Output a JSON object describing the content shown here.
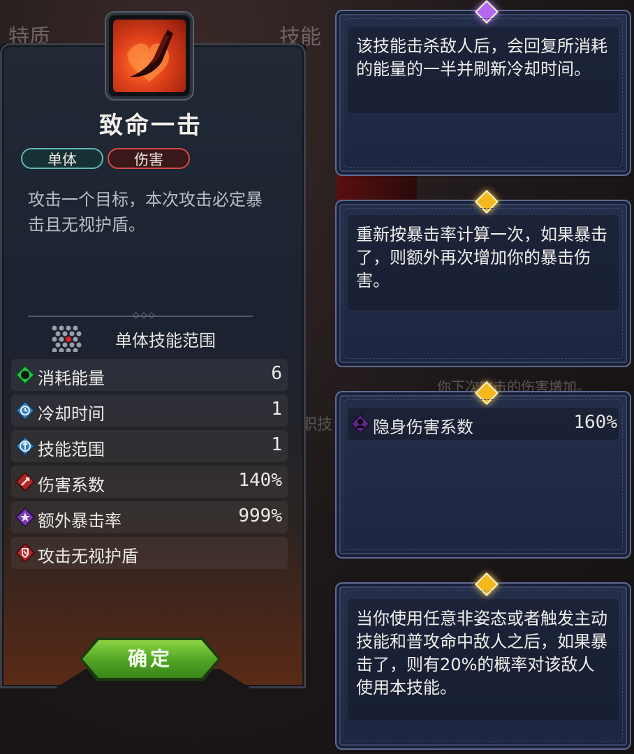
{
  "background": {
    "tab_traits": "特质",
    "tab_skills": "技能",
    "faded_text_1": "你下次攻击的伤害增加。",
    "faded_text_2": "职技"
  },
  "skill": {
    "name": "致命一击",
    "icon": "slash-attack-icon",
    "tags": [
      "单体",
      "伤害"
    ],
    "description": "攻击一个目标，本次攻击必定暴击且无视护盾。",
    "range_label": "单体技能范围",
    "stats": [
      {
        "icon": "energy-icon",
        "label": "消耗能量",
        "value": "6",
        "color": "#22c24a"
      },
      {
        "icon": "cooldown-icon",
        "label": "冷却时间",
        "value": "1",
        "color": "#3a7fb8"
      },
      {
        "icon": "range-icon",
        "label": "技能范围",
        "value": "1",
        "color": "#3a7fb8"
      },
      {
        "icon": "damage-icon",
        "label": "伤害系数",
        "value": "140%",
        "color": "#b0282a"
      },
      {
        "icon": "crit-icon",
        "label": "额外暴击率",
        "value": "999%",
        "color": "#7a3ab0"
      },
      {
        "icon": "shield-break-icon",
        "label": "攻击无视护盾",
        "value": "",
        "color": "#b0282a"
      }
    ],
    "confirm_label": "确定"
  },
  "cards": [
    {
      "gem": "purple",
      "text": "该技能击杀敌人后，会回复所消耗的能量的一半并刷新冷却时间。"
    },
    {
      "gem": "gold",
      "text": "重新按暴击率计算一次，如果暴击了，则额外再次增加你的暴击伤害。"
    },
    {
      "gem": "gold",
      "stat": {
        "icon": "stealth-icon",
        "label": "隐身伤害系数",
        "value": "160%"
      }
    },
    {
      "gem": "gold",
      "text": "当你使用任意非姿态或者触发主动技能和普攻命中敌人之后，如果暴击了，则有20%的概率对该敌人使用本技能。"
    }
  ],
  "colors": {
    "accent_green": "#4fa424",
    "tag_single": "#5fb8b6",
    "tag_damage": "#d54a4a",
    "card_border": "#5e6b93"
  }
}
